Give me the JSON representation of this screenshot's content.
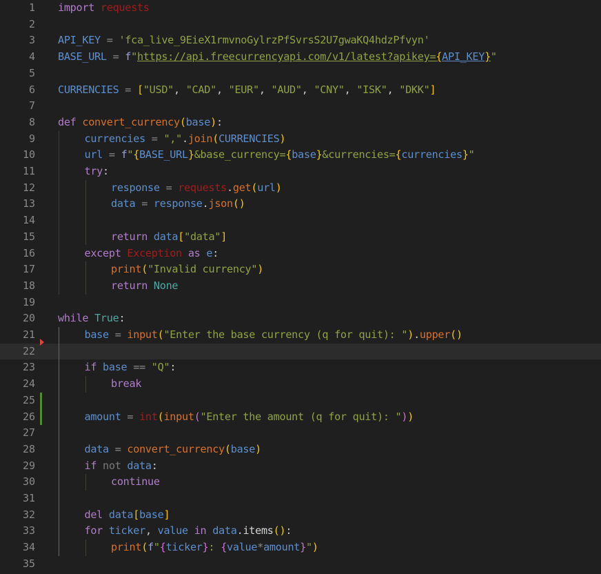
{
  "editor": {
    "language": "python",
    "current_line": 22,
    "modified_lines": [
      25,
      26
    ],
    "breakpoint_arrow_line": 21,
    "colors": {
      "background": "#1f1f1f",
      "current_line_bg": "#2c2c2c",
      "line_number": "#8a8a8a",
      "keyword": "#b07ec8",
      "module": "#a01d1d",
      "identifier": "#5d8fce",
      "string": "#8fa344",
      "function": "#d87228",
      "bracket_1": "#f2c80a",
      "bracket_2": "#d070d6",
      "builtin_const": "#4ea8a0",
      "modified_gutter": "#548c26",
      "arrow_marker": "#e0443e"
    },
    "lines": [
      {
        "n": "1",
        "tokens": [
          [
            "kw",
            "import"
          ],
          [
            "pn",
            " "
          ],
          [
            "mod",
            "requests"
          ]
        ]
      },
      {
        "n": "2",
        "tokens": []
      },
      {
        "n": "3",
        "tokens": [
          [
            "var",
            "API_KEY"
          ],
          [
            "op",
            " = "
          ],
          [
            "str",
            "'fca_live_9EieX1rmvnoGylrzPfSvrsS2U7gwaKQ4hdzPfvyn'"
          ]
        ]
      },
      {
        "n": "4",
        "tokens": [
          [
            "var",
            "BASE_URL"
          ],
          [
            "op",
            " = "
          ],
          [
            "kwc",
            "f"
          ],
          [
            "str",
            "\""
          ],
          [
            "str url",
            "https://api.freecurrencyapi.com/v1/latest?apikey="
          ],
          [
            "b1 url",
            "{"
          ],
          [
            "var urlv",
            "API_KEY"
          ],
          [
            "b1 url",
            "}"
          ],
          [
            "str",
            "\""
          ]
        ]
      },
      {
        "n": "5",
        "tokens": []
      },
      {
        "n": "6",
        "tokens": [
          [
            "var",
            "CURRENCIES"
          ],
          [
            "op",
            " = "
          ],
          [
            "b1",
            "["
          ],
          [
            "str",
            "\"USD\""
          ],
          [
            "pn",
            ", "
          ],
          [
            "str",
            "\"CAD\""
          ],
          [
            "pn",
            ", "
          ],
          [
            "str",
            "\"EUR\""
          ],
          [
            "pn",
            ", "
          ],
          [
            "str",
            "\"AUD\""
          ],
          [
            "pn",
            ", "
          ],
          [
            "str",
            "\"CNY\""
          ],
          [
            "pn",
            ", "
          ],
          [
            "str",
            "\"ISK\""
          ],
          [
            "pn",
            ", "
          ],
          [
            "str",
            "\"DKK\""
          ],
          [
            "b1",
            "]"
          ]
        ]
      },
      {
        "n": "7",
        "tokens": []
      },
      {
        "n": "8",
        "tokens": [
          [
            "kw",
            "def"
          ],
          [
            "pn",
            " "
          ],
          [
            "fn",
            "convert_currency"
          ],
          [
            "b1",
            "("
          ],
          [
            "var",
            "base"
          ],
          [
            "b1",
            ")"
          ],
          [
            "pn",
            ":"
          ]
        ]
      },
      {
        "n": "9",
        "indent": 1,
        "tokens": [
          [
            "var",
            "currencies"
          ],
          [
            "op",
            " = "
          ],
          [
            "str",
            "\",\""
          ],
          [
            "pn",
            "."
          ],
          [
            "fn",
            "join"
          ],
          [
            "b1",
            "("
          ],
          [
            "var",
            "CURRENCIES"
          ],
          [
            "b1",
            ")"
          ]
        ]
      },
      {
        "n": "10",
        "indent": 1,
        "tokens": [
          [
            "var",
            "url"
          ],
          [
            "op",
            " = "
          ],
          [
            "kwc",
            "f"
          ],
          [
            "str",
            "\""
          ],
          [
            "b1",
            "{"
          ],
          [
            "var",
            "BASE_URL"
          ],
          [
            "b1",
            "}"
          ],
          [
            "str",
            "&base_currency="
          ],
          [
            "b1",
            "{"
          ],
          [
            "var",
            "base"
          ],
          [
            "b1",
            "}"
          ],
          [
            "str",
            "&currencies="
          ],
          [
            "b1",
            "{"
          ],
          [
            "var",
            "currencies"
          ],
          [
            "b1",
            "}"
          ],
          [
            "str",
            "\""
          ]
        ]
      },
      {
        "n": "11",
        "indent": 1,
        "tokens": [
          [
            "kw",
            "try"
          ],
          [
            "pn",
            ":"
          ]
        ]
      },
      {
        "n": "12",
        "indent": 2,
        "tokens": [
          [
            "var",
            "response"
          ],
          [
            "op",
            " = "
          ],
          [
            "mod",
            "requests"
          ],
          [
            "pn",
            "."
          ],
          [
            "fn",
            "get"
          ],
          [
            "b1",
            "("
          ],
          [
            "var",
            "url"
          ],
          [
            "b1",
            ")"
          ]
        ]
      },
      {
        "n": "13",
        "indent": 2,
        "tokens": [
          [
            "var",
            "data"
          ],
          [
            "op",
            " = "
          ],
          [
            "var",
            "response"
          ],
          [
            "pn",
            "."
          ],
          [
            "fn",
            "json"
          ],
          [
            "b1",
            "()"
          ]
        ]
      },
      {
        "n": "14",
        "tokens": []
      },
      {
        "n": "15",
        "indent": 2,
        "tokens": [
          [
            "kw",
            "return"
          ],
          [
            "pn",
            " "
          ],
          [
            "var",
            "data"
          ],
          [
            "b1",
            "["
          ],
          [
            "str",
            "\"data\""
          ],
          [
            "b1",
            "]"
          ]
        ]
      },
      {
        "n": "16",
        "indent": 1,
        "tokens": [
          [
            "kw",
            "except"
          ],
          [
            "pn",
            " "
          ],
          [
            "mod",
            "Exception"
          ],
          [
            "pn",
            " "
          ],
          [
            "kw",
            "as"
          ],
          [
            "pn",
            " "
          ],
          [
            "var",
            "e"
          ],
          [
            "pn",
            ":"
          ]
        ]
      },
      {
        "n": "17",
        "indent": 2,
        "tokens": [
          [
            "fn",
            "print"
          ],
          [
            "b1",
            "("
          ],
          [
            "str",
            "\"Invalid currency\""
          ],
          [
            "b1",
            ")"
          ]
        ]
      },
      {
        "n": "18",
        "indent": 2,
        "tokens": [
          [
            "kw",
            "return"
          ],
          [
            "pn",
            " "
          ],
          [
            "bi",
            "None"
          ]
        ]
      },
      {
        "n": "19",
        "tokens": []
      },
      {
        "n": "20",
        "tokens": [
          [
            "kw",
            "while"
          ],
          [
            "pn",
            " "
          ],
          [
            "bi",
            "True"
          ],
          [
            "pn",
            ":"
          ]
        ]
      },
      {
        "n": "21",
        "indent": 1,
        "tokens": [
          [
            "var",
            "base"
          ],
          [
            "op",
            " = "
          ],
          [
            "fn",
            "input"
          ],
          [
            "b1",
            "("
          ],
          [
            "str",
            "\"Enter the base currency (q for quit): \""
          ],
          [
            "b1",
            ")"
          ],
          [
            "pn",
            "."
          ],
          [
            "fn",
            "upper"
          ],
          [
            "b1",
            "()"
          ]
        ]
      },
      {
        "n": "22",
        "tokens": []
      },
      {
        "n": "23",
        "indent": 1,
        "tokens": [
          [
            "kw",
            "if"
          ],
          [
            "pn",
            " "
          ],
          [
            "var",
            "base"
          ],
          [
            "op",
            " == "
          ],
          [
            "str",
            "\"Q\""
          ],
          [
            "pn",
            ":"
          ]
        ]
      },
      {
        "n": "24",
        "indent": 2,
        "tokens": [
          [
            "kw",
            "break"
          ]
        ]
      },
      {
        "n": "25",
        "tokens": []
      },
      {
        "n": "26",
        "indent": 1,
        "tokens": [
          [
            "var",
            "amount"
          ],
          [
            "op",
            " = "
          ],
          [
            "mod",
            "int"
          ],
          [
            "b1",
            "("
          ],
          [
            "fn",
            "input"
          ],
          [
            "b2",
            "("
          ],
          [
            "str",
            "\"Enter the amount (q for quit): \""
          ],
          [
            "b2",
            ")"
          ],
          [
            "b1",
            ")"
          ]
        ]
      },
      {
        "n": "27",
        "tokens": []
      },
      {
        "n": "28",
        "indent": 1,
        "tokens": [
          [
            "var",
            "data"
          ],
          [
            "op",
            " = "
          ],
          [
            "fn",
            "convert_currency"
          ],
          [
            "b1",
            "("
          ],
          [
            "var",
            "base"
          ],
          [
            "b1",
            ")"
          ]
        ]
      },
      {
        "n": "29",
        "indent": 1,
        "tokens": [
          [
            "kw",
            "if"
          ],
          [
            "pn",
            " "
          ],
          [
            "dim",
            "not"
          ],
          [
            "pn",
            " "
          ],
          [
            "var",
            "data"
          ],
          [
            "pn",
            ":"
          ]
        ]
      },
      {
        "n": "30",
        "indent": 2,
        "tokens": [
          [
            "kw",
            "continue"
          ]
        ]
      },
      {
        "n": "31",
        "tokens": []
      },
      {
        "n": "32",
        "indent": 1,
        "tokens": [
          [
            "kw",
            "del"
          ],
          [
            "pn",
            " "
          ],
          [
            "var",
            "data"
          ],
          [
            "b1",
            "["
          ],
          [
            "var",
            "base"
          ],
          [
            "b1",
            "]"
          ]
        ]
      },
      {
        "n": "33",
        "indent": 1,
        "tokens": [
          [
            "kw",
            "for"
          ],
          [
            "pn",
            " "
          ],
          [
            "var",
            "ticker"
          ],
          [
            "pn",
            ", "
          ],
          [
            "var",
            "value"
          ],
          [
            "pn",
            " "
          ],
          [
            "kw",
            "in"
          ],
          [
            "pn",
            " "
          ],
          [
            "var",
            "data"
          ],
          [
            "pn",
            "."
          ],
          [
            "white",
            "items"
          ],
          [
            "b1",
            "()"
          ],
          [
            "pn",
            ":"
          ]
        ]
      },
      {
        "n": "34",
        "indent": 2,
        "tokens": [
          [
            "fn",
            "print"
          ],
          [
            "b1",
            "("
          ],
          [
            "kwc",
            "f"
          ],
          [
            "str",
            "\""
          ],
          [
            "b2",
            "{"
          ],
          [
            "var",
            "ticker"
          ],
          [
            "b2",
            "}"
          ],
          [
            "str",
            ": "
          ],
          [
            "b2",
            "{"
          ],
          [
            "var",
            "value"
          ],
          [
            "op",
            "*"
          ],
          [
            "var",
            "amount"
          ],
          [
            "b2",
            "}"
          ],
          [
            "str",
            "\""
          ],
          [
            "b1",
            ")"
          ]
        ]
      },
      {
        "n": "35",
        "tokens": []
      }
    ]
  }
}
